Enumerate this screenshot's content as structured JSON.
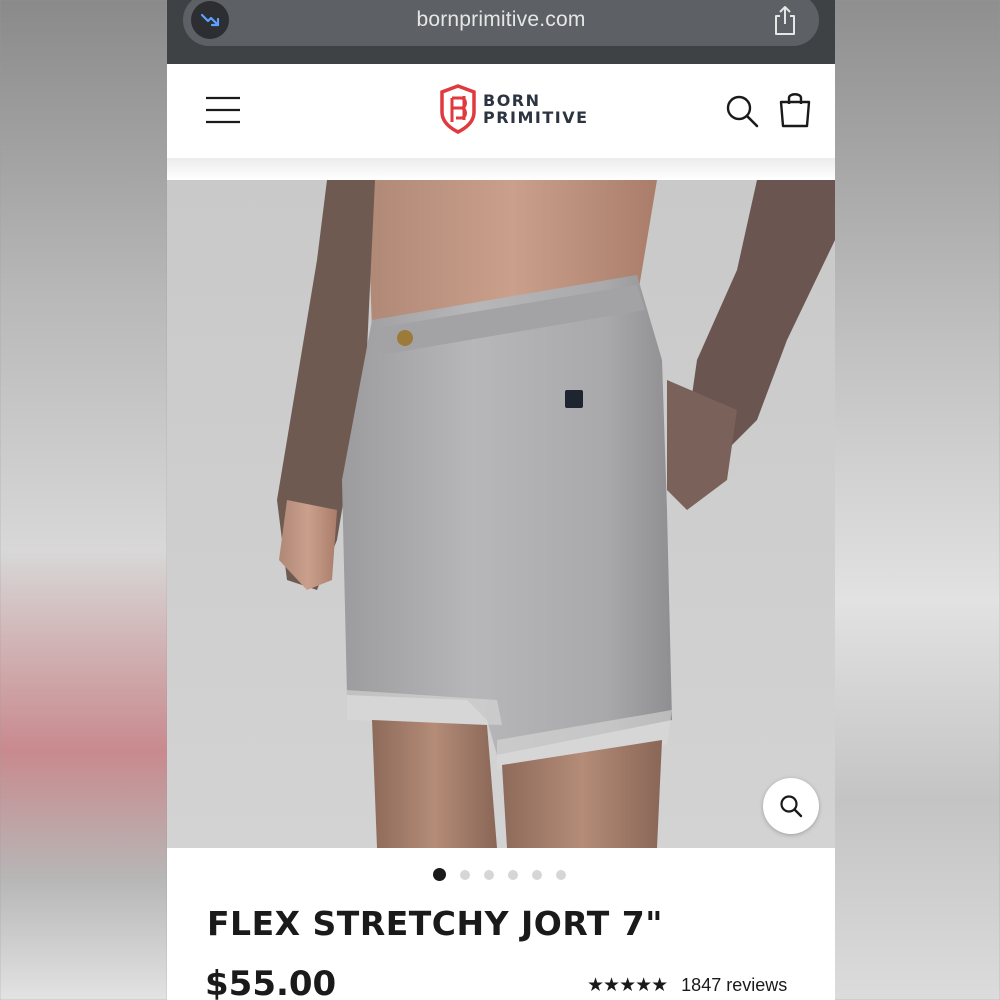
{
  "browser": {
    "url": "bornprimitive.com"
  },
  "header": {
    "brand_line1": "BORN",
    "brand_line2": "PRIMITIVE"
  },
  "gallery": {
    "total_images": 6,
    "active_index": 0
  },
  "product": {
    "title": "FLEX STRETCHY JORT 7\"",
    "price": "$55.00",
    "stars": "★★★★★",
    "reviews": "1847 reviews"
  },
  "colors": {
    "brand_red": "#e0393e",
    "brand_navy": "#2b3440",
    "text": "#1a1a1a"
  },
  "icons": [
    "trending-icon",
    "share-icon",
    "menu-icon",
    "search-icon",
    "cart-icon",
    "zoom-icon"
  ]
}
